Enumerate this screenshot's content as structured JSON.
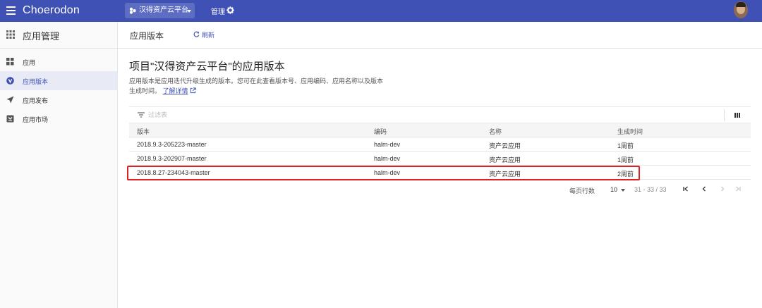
{
  "app": {
    "title": "Choerodon"
  },
  "topbar": {
    "project": "汉得资产云平台",
    "manage_label": "管理"
  },
  "sidebar": {
    "title": "应用管理",
    "items": [
      {
        "label": "应用",
        "icon": "apps-icon"
      },
      {
        "label": "应用版本",
        "icon": "version-icon",
        "active": true
      },
      {
        "label": "应用发布",
        "icon": "send-icon"
      },
      {
        "label": "应用市场",
        "icon": "market-icon"
      }
    ]
  },
  "page": {
    "title": "应用版本",
    "refresh_label": "刷新",
    "section_title": "项目\"汉得资产云平台\"的应用版本",
    "description": "应用版本是应用迭代升级生成的版本。您可在此查看版本号、应用编码、应用名称以及版本生成时间。",
    "learn_more": "了解详情"
  },
  "filter": {
    "placeholder": "过滤表"
  },
  "table": {
    "headers": [
      "版本",
      "编码",
      "名称",
      "生成时间"
    ],
    "rows": [
      [
        "2018.9.3-205223-master",
        "halm-dev",
        "资产云应用",
        "1周前"
      ],
      [
        "2018.9.3-202907-master",
        "halm-dev",
        "资产云应用",
        "1周前"
      ],
      [
        "2018.8.27-234043-master",
        "halm-dev",
        "资产云应用",
        "2周前"
      ]
    ]
  },
  "pagination": {
    "rows_per_page_label": "每页行数",
    "rows_per_page": "10",
    "range": "31 - 33 / 33"
  },
  "colors": {
    "primary": "#3f51b5",
    "sidebar_active_bg": "#e8eaf6",
    "highlight_border": "#e02020"
  }
}
